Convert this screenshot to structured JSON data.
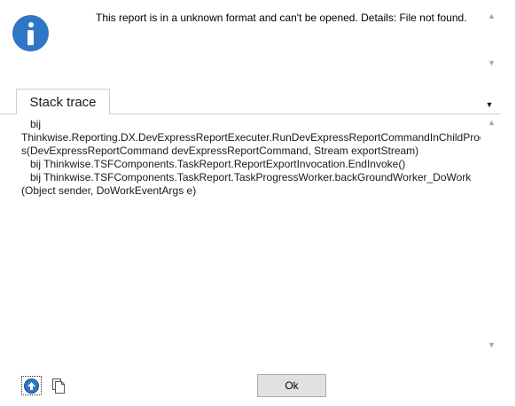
{
  "message": {
    "text": "This report is in a unknown format and can't be opened. Details: File not found."
  },
  "tabs": [
    {
      "label": "Stack trace"
    }
  ],
  "stack_trace": {
    "lines": [
      "bij",
      "Thinkwise.Reporting.DX.DevExpressReportExecuter.RunDevExpressReportCommandInChildProces",
      "s(DevExpressReportCommand devExpressReportCommand, Stream exportStream)",
      "bij Thinkwise.TSFComponents.TaskReport.ReportExportInvocation.EndInvoke()",
      "bij Thinkwise.TSFComponents.TaskReport.TaskProgressWorker.backGroundWorker_DoWork",
      "(Object sender, DoWorkEventArgs e)"
    ]
  },
  "buttons": {
    "ok_label": "Ok"
  },
  "icons": {
    "info": "info-icon",
    "upload": "upload-icon",
    "copy": "copy-icon",
    "dropdown": "chevron-down-icon"
  },
  "colors": {
    "accent": "#2e76c6",
    "button_bg": "#e1e1e1"
  }
}
